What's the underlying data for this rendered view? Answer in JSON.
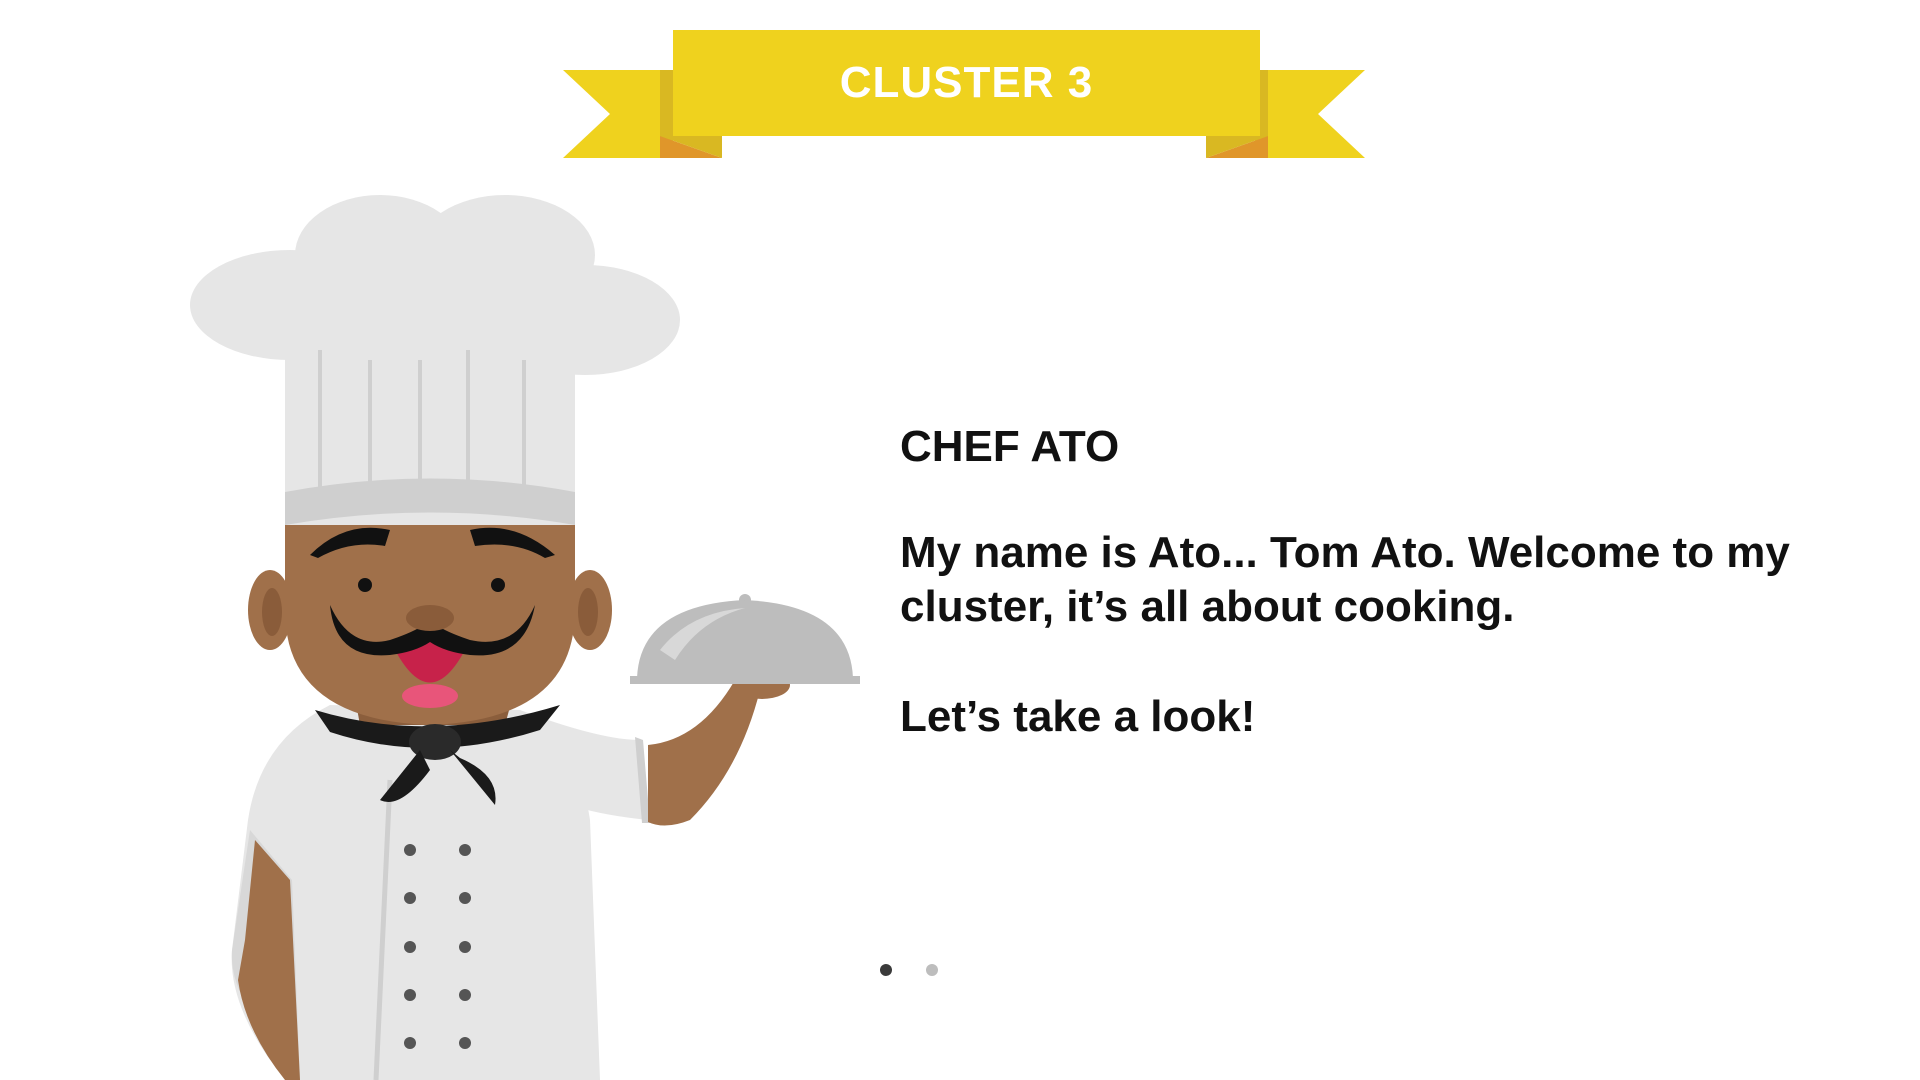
{
  "banner": {
    "title": "CLUSTER 3"
  },
  "intro": {
    "chef_name": "CHEF ATO",
    "welcome": "My name is Ato... Tom Ato. Welcome to my cluster, it’s all about cooking.",
    "call_to_action": "Let’s take a look!"
  },
  "illustration": {
    "character": "chef",
    "props": [
      "chef-hat-icon",
      "serving-cloche-icon",
      "neckerchief-icon"
    ]
  },
  "pager": {
    "total": 2,
    "active_index": 0
  },
  "colors": {
    "ribbon": "#EFD21E",
    "ribbon_shadow": "#D9B822",
    "ribbon_fold": "#E0962A",
    "skin": "#A0704A",
    "coat": "#E6E6E6",
    "text": "#111111"
  }
}
